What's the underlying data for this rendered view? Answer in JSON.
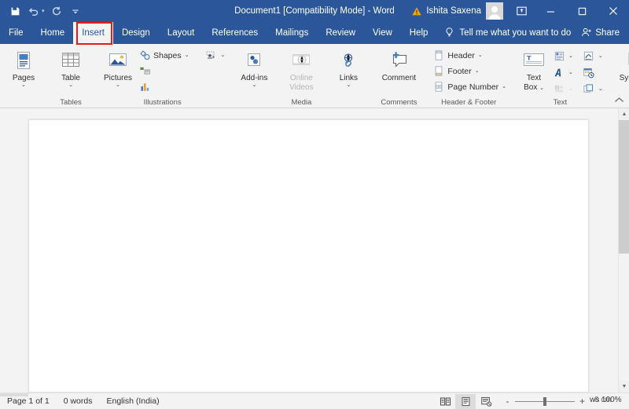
{
  "window": {
    "title": "Document1 [Compatibility Mode]  -  Word",
    "account_name": "Ishita Saxena",
    "warning_icon": "warning-triangle-icon",
    "avatar": "user-avatar",
    "ribbon_display_options": "ribbon-display-options-icon",
    "minimize": "minimize-icon",
    "maximize": "maximize-icon",
    "close": "close-icon",
    "titlebar_color": "#2b579a"
  },
  "quick_access": {
    "save": "Save",
    "undo": "Undo",
    "redo": "Redo",
    "customize": "Customize Quick Access Toolbar"
  },
  "tabs": [
    {
      "label": "File",
      "active": false
    },
    {
      "label": "Home",
      "active": false
    },
    {
      "label": "Insert",
      "active": true
    },
    {
      "label": "Design",
      "active": false
    },
    {
      "label": "Layout",
      "active": false
    },
    {
      "label": "References",
      "active": false
    },
    {
      "label": "Mailings",
      "active": false
    },
    {
      "label": "Review",
      "active": false
    },
    {
      "label": "View",
      "active": false
    },
    {
      "label": "Help",
      "active": false
    }
  ],
  "highlight": {
    "target": "Insert",
    "color": "#e41b17"
  },
  "tell_me": {
    "label": "Tell me what you want to do",
    "icon": "lightbulb-icon"
  },
  "share": {
    "label": "Share",
    "icon": "share-person-icon"
  },
  "ribbon": {
    "groups": [
      {
        "name": "pages",
        "label": "",
        "buttons": [
          {
            "label": "Pages",
            "icon": "cover-page-icon",
            "has_dropdown": true
          }
        ]
      },
      {
        "name": "tables",
        "label": "Tables",
        "buttons": [
          {
            "label": "Table",
            "icon": "table-grid-icon",
            "has_dropdown": true
          }
        ]
      },
      {
        "name": "illustrations",
        "label": "Illustrations",
        "buttons": [
          {
            "label": "Pictures",
            "icon": "pictures-icon",
            "has_dropdown": true
          }
        ],
        "small_items": [
          {
            "label": "Shapes",
            "icon": "shapes-icon",
            "has_dropdown": true
          },
          {
            "label": "",
            "icon": "icons-gallery-icon",
            "has_dropdown": true
          },
          {
            "label": "",
            "icon": "smartart-icon",
            "has_dropdown": false
          },
          {
            "label": "",
            "icon": "chart-icon",
            "has_dropdown": false
          }
        ]
      },
      {
        "name": "addins",
        "label": "",
        "buttons": [
          {
            "label": "Add-ins",
            "icon": "addins-puzzle-icon",
            "has_dropdown": true
          }
        ]
      },
      {
        "name": "media",
        "label": "Media",
        "buttons": [
          {
            "label": "Online Videos",
            "icon": "online-video-icon",
            "has_dropdown": false,
            "disabled": true
          }
        ]
      },
      {
        "name": "links",
        "label": "",
        "buttons": [
          {
            "label": "Links",
            "icon": "links-globe-icon",
            "has_dropdown": true
          }
        ]
      },
      {
        "name": "comments",
        "label": "Comments",
        "buttons": [
          {
            "label": "Comment",
            "icon": "new-comment-icon",
            "has_dropdown": false
          }
        ]
      },
      {
        "name": "header_footer",
        "label": "Header & Footer",
        "small_items": [
          {
            "label": "Header",
            "icon": "header-page-icon",
            "has_dropdown": true
          },
          {
            "label": "Footer",
            "icon": "footer-page-icon",
            "has_dropdown": true
          },
          {
            "label": "Page Number",
            "icon": "page-number-icon",
            "has_dropdown": true
          }
        ]
      },
      {
        "name": "text",
        "label": "Text",
        "buttons": [
          {
            "label": "Text Box",
            "icon": "text-box-icon",
            "has_dropdown": true
          }
        ],
        "small_items": [
          {
            "label": "",
            "icon": "quick-parts-icon",
            "has_dropdown": true
          },
          {
            "label": "",
            "icon": "signature-line-icon",
            "has_dropdown": true
          },
          {
            "label": "",
            "icon": "wordart-icon",
            "has_dropdown": true
          },
          {
            "label": "",
            "icon": "date-time-icon",
            "has_dropdown": false
          },
          {
            "label": "",
            "icon": "drop-cap-icon",
            "has_dropdown": true,
            "disabled": true
          },
          {
            "label": "",
            "icon": "object-icon",
            "has_dropdown": true
          }
        ]
      },
      {
        "name": "symbols",
        "label": "",
        "buttons": [
          {
            "label": "Symbols",
            "icon": "omega-symbol-icon",
            "has_dropdown": true
          }
        ]
      }
    ],
    "collapse_icon": "collapse-ribbon-chevron-icon"
  },
  "document": {
    "page_background": "#ffffff"
  },
  "scrollbar": {
    "up_arrow": "scroll-up-arrow-icon",
    "down_arrow": "scroll-down-arrow-icon"
  },
  "status_bar": {
    "page": "Page 1 of 1",
    "words": "0 words",
    "language": "English (India)",
    "views": [
      {
        "name": "read-mode-view",
        "icon": "read-mode-icon",
        "selected": false
      },
      {
        "name": "print-layout-view",
        "icon": "print-layout-icon",
        "selected": true
      },
      {
        "name": "web-layout-view",
        "icon": "web-layout-icon",
        "selected": false
      }
    ],
    "zoom_out": "-",
    "zoom_in": "+",
    "zoom_label_a": "ws 100%",
    "zoom_label_b": "0 cm"
  }
}
